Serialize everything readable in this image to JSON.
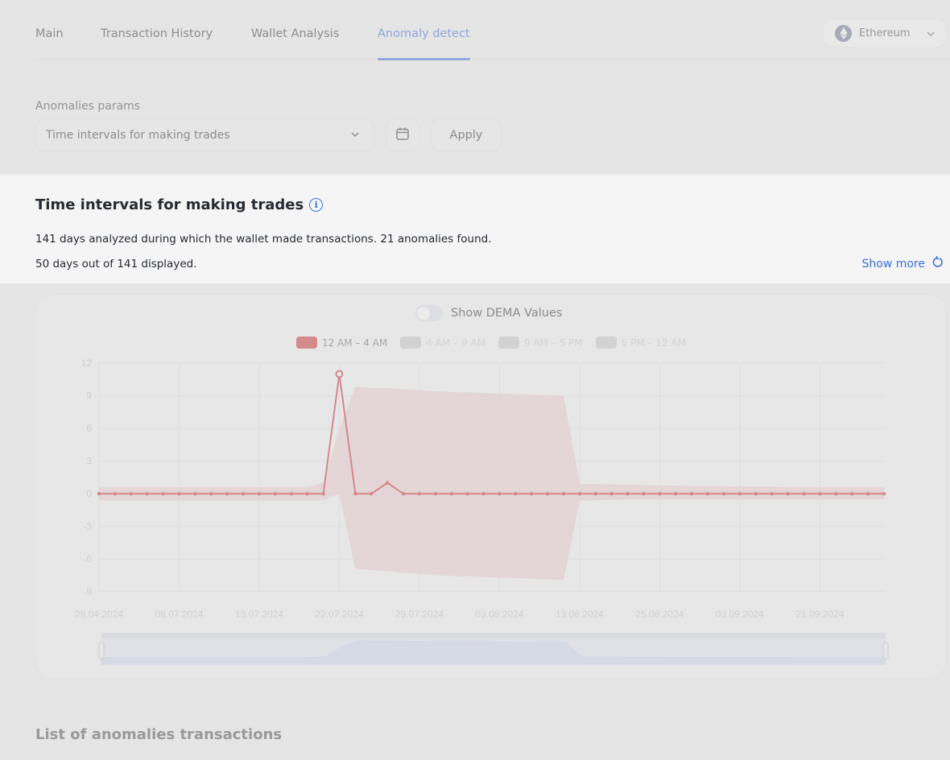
{
  "tabs": [
    {
      "label": "Main",
      "active": false
    },
    {
      "label": "Transaction History",
      "active": false
    },
    {
      "label": "Wallet Analysis",
      "active": false
    },
    {
      "label": "Anomaly detect",
      "active": true
    }
  ],
  "network_selector": {
    "label": "Ethereum",
    "icon": "ethereum-icon"
  },
  "params": {
    "label": "Anomalies params",
    "selected": "Time intervals for making trades",
    "calendar_icon": "calendar-icon",
    "apply_label": "Apply"
  },
  "info": {
    "title": "Time intervals for making trades",
    "info_icon": "i",
    "line1": "141 days analyzed during which the wallet made transactions. 21 anomalies found.",
    "line2": "50 days out of 141 displayed.",
    "show_more_label": "Show more"
  },
  "chart_controls": {
    "dema_toggle_label": "Show DEMA Values",
    "dema_enabled": false
  },
  "colors": {
    "accent": "#93a6dd",
    "link": "#3a6fe0",
    "series_active": "#d4898b",
    "band": "#e3d1d3",
    "legend_inactive": "#d2d2d2"
  },
  "chart_data": {
    "type": "line",
    "title": "",
    "xlabel": "",
    "ylabel": "",
    "ylim": [
      -9,
      12
    ],
    "yticks": [
      12,
      9,
      6,
      3,
      0,
      -3,
      -6,
      -9
    ],
    "xtick_labels": [
      "28.04.2024",
      "08.07.2024",
      "13.07.2024",
      "22.07.2024",
      "29.07.2024",
      "03.08.2024",
      "13.08.2024",
      "25.08.2024",
      "03.09.2024",
      "21.09.2024"
    ],
    "xtick_index": [
      0,
      5,
      10,
      15,
      20,
      25,
      30,
      35,
      40,
      45
    ],
    "grid": true,
    "legend_position": "top-center",
    "legend": [
      {
        "label": "12 AM – 4 AM",
        "active": true
      },
      {
        "label": "4 AM – 9 AM",
        "active": false
      },
      {
        "label": "9 AM – 5 PM",
        "active": false
      },
      {
        "label": "5 PM – 12 AM",
        "active": false
      }
    ],
    "series": [
      {
        "name": "12 AM – 4 AM",
        "values": [
          0,
          0,
          0,
          0,
          0,
          0,
          0,
          0,
          0,
          0,
          0,
          0,
          0,
          0,
          0,
          11,
          0,
          0,
          1,
          0,
          0,
          0,
          0,
          0,
          0,
          0,
          0,
          0,
          0,
          0,
          0,
          0,
          0,
          0,
          0,
          0,
          0,
          0,
          0,
          0,
          0,
          0,
          0,
          0,
          0,
          0,
          0,
          0,
          0,
          0
        ],
        "anomaly_index": [
          15
        ],
        "band_upper": [
          0.6,
          0.6,
          0.6,
          0.6,
          0.6,
          0.6,
          0.6,
          0.6,
          0.6,
          0.6,
          0.6,
          0.6,
          0.6,
          0.6,
          1.0,
          6.0,
          9.8,
          9.7,
          9.7,
          9.6,
          9.5,
          9.4,
          9.35,
          9.3,
          9.25,
          9.2,
          9.15,
          9.1,
          9.05,
          9.0,
          0.9,
          0.9,
          0.85,
          0.8,
          0.8,
          0.75,
          0.75,
          0.7,
          0.7,
          0.7,
          0.65,
          0.65,
          0.65,
          0.6,
          0.6,
          0.6,
          0.6,
          0.6,
          0.6,
          0.6
        ],
        "band_lower": [
          -0.6,
          -0.6,
          -0.6,
          -0.6,
          -0.6,
          -0.6,
          -0.6,
          -0.6,
          -0.6,
          -0.6,
          -0.6,
          -0.6,
          -0.6,
          -0.6,
          -0.6,
          0.0,
          -6.9,
          -7.0,
          -7.1,
          -7.25,
          -7.35,
          -7.45,
          -7.55,
          -7.6,
          -7.65,
          -7.7,
          -7.75,
          -7.8,
          -7.85,
          -7.9,
          -0.6,
          -0.6,
          -0.55,
          -0.5,
          -0.5,
          -0.5,
          -0.5,
          -0.5,
          -0.5,
          -0.5,
          -0.5,
          -0.5,
          -0.5,
          -0.5,
          -0.5,
          -0.5,
          -0.5,
          -0.5,
          -0.5,
          -0.5
        ]
      }
    ],
    "overview_range": [
      0,
      1
    ]
  },
  "list_section": {
    "title": "List of anomalies transactions"
  }
}
